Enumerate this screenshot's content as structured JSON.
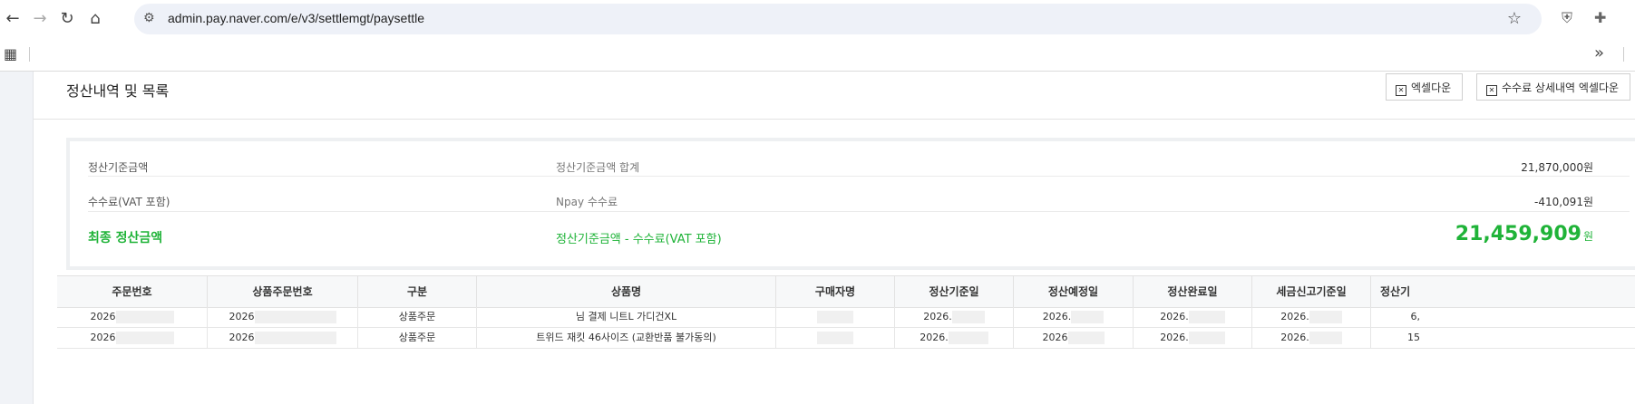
{
  "browser": {
    "url": "admin.pay.naver.com/e/v3/settlemgt/paysettle"
  },
  "section": {
    "title": "정산내역 및 목록",
    "excel_button": "엑셀다운",
    "fee_excel_button": "수수료 상세내역 엑셀다운"
  },
  "summary": {
    "base": {
      "label": "정산기준금액",
      "desc": "정산기준금액 합계",
      "amount": "21,870,000원"
    },
    "fee": {
      "label": "수수료(VAT 포함)",
      "desc": "Npay 수수료",
      "amount": "-410,091원"
    },
    "final": {
      "label": "최종 정산금액",
      "desc": "정산기준금액 - 수수료(VAT 포함)",
      "amount": "21,459,909",
      "unit": "원"
    }
  },
  "table": {
    "headers": [
      "주문번호",
      "상품주문번호",
      "구분",
      "상품명",
      "구매자명",
      "정산기준일",
      "정산예정일",
      "정산완료일",
      "세금신고기준일",
      "정산기"
    ],
    "rows": [
      [
        "2026",
        "2026",
        "상품주문",
        "님 결제 니트L 가디건XL",
        "",
        "2026.",
        "2026.",
        "2026.",
        "2026.",
        "6,"
      ],
      [
        "2026",
        "2026",
        "상품주문",
        "트위드 재킷 46사이즈 (교환반품 불가동의)",
        "",
        "2026.",
        "2026",
        "2026.",
        "2026.",
        "15"
      ]
    ]
  },
  "colors": {
    "accent_green": "#1fb338"
  }
}
